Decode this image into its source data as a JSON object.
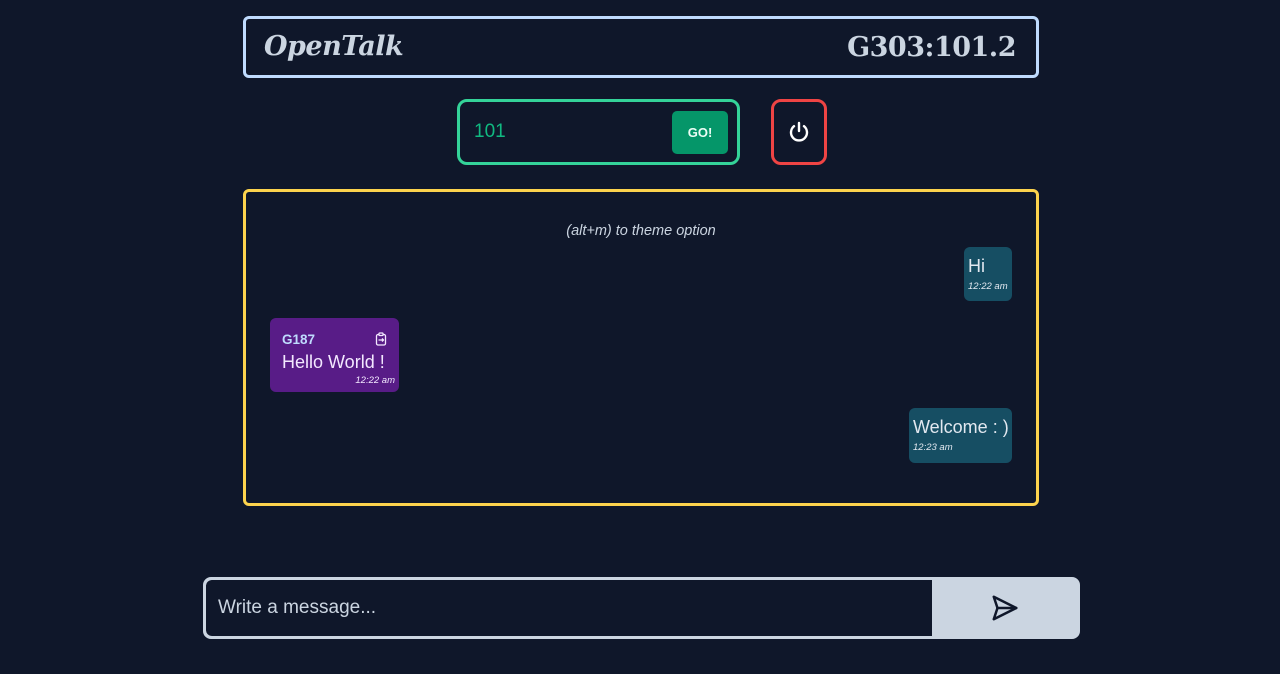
{
  "header": {
    "brand": "OpenTalk",
    "user_id": "G303:101.2"
  },
  "room": {
    "value": "101",
    "go_label": "GO!"
  },
  "power": {
    "icon": "power-icon"
  },
  "chat": {
    "hint": "(alt+m)  to theme option",
    "messages": [
      {
        "direction": "outgoing",
        "text": "Hi",
        "time": "12:22 am"
      },
      {
        "direction": "incoming",
        "sender": "G187",
        "text": "Hello World !",
        "time": "12:22 am",
        "icon": "copy-icon"
      },
      {
        "direction": "outgoing",
        "text": "Welcome : )",
        "time": "12:23 am"
      }
    ]
  },
  "composer": {
    "placeholder": "Write a message...",
    "send_icon": "send-icon"
  },
  "colors": {
    "background": "#0f172a",
    "header_border": "#bfdbfe",
    "room_border": "#34d399",
    "go_button": "#059669",
    "power_border": "#ef4444",
    "chat_border": "#fcd34d",
    "outgoing_bubble": "#164e63",
    "incoming_bubble": "#581c87",
    "composer": "#cbd5e1"
  }
}
